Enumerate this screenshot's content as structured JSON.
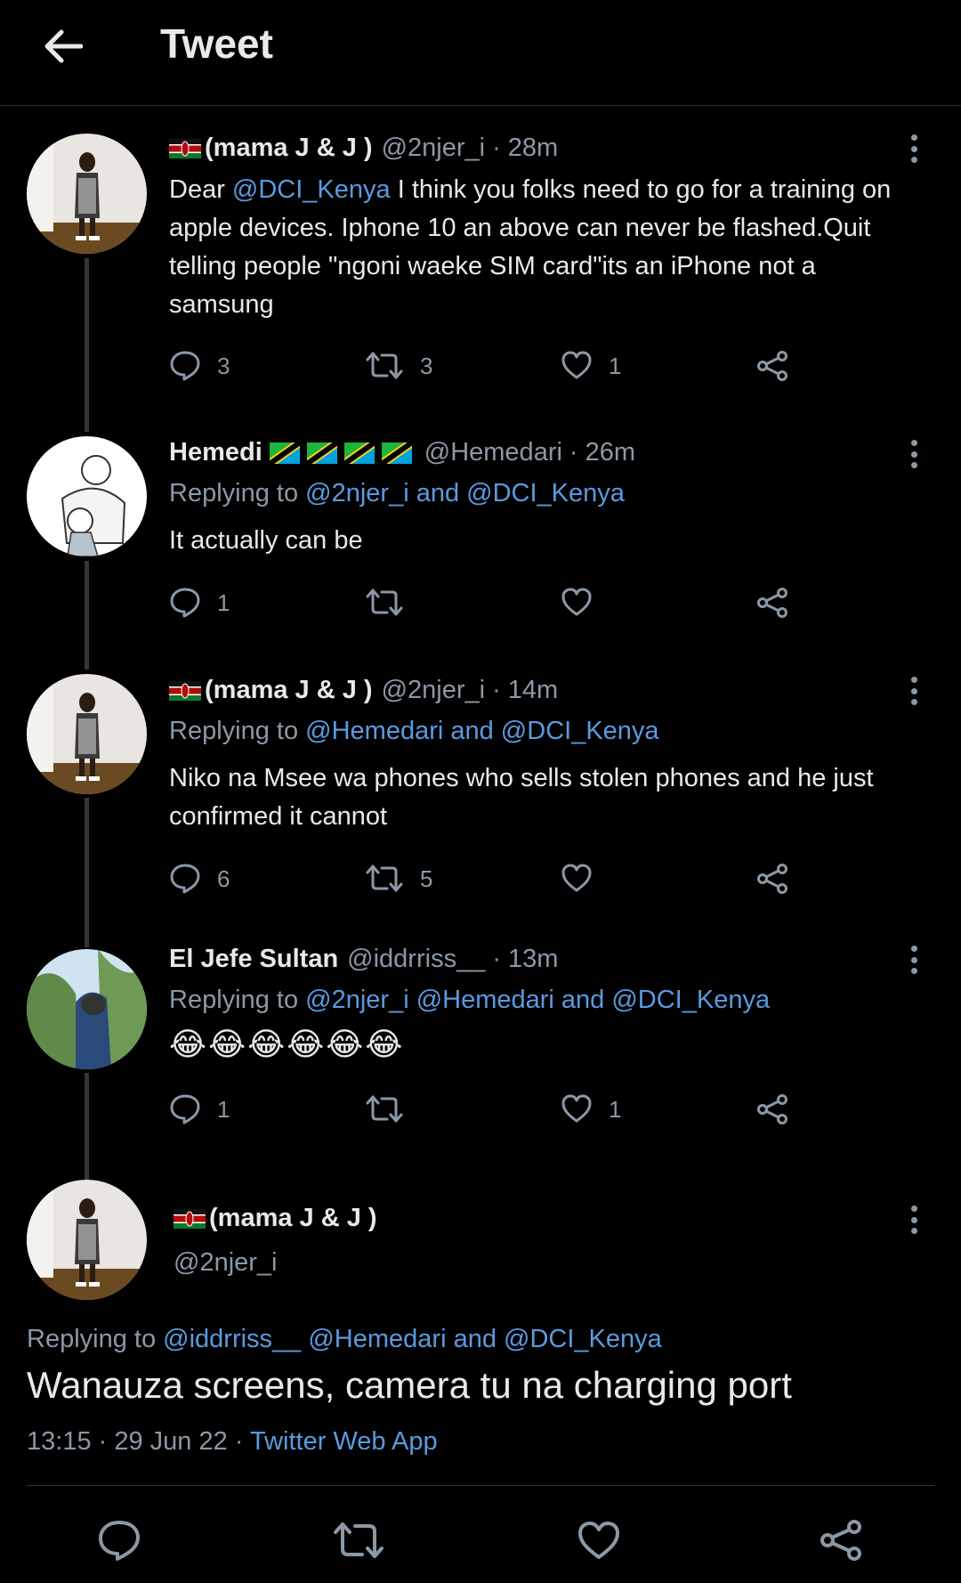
{
  "header": {
    "title": "Tweet"
  },
  "tweets": [
    {
      "name": "(mama J & J )",
      "handle": "@2njer_i",
      "time": "28m",
      "reply_prefix": "",
      "reply_mentions": "",
      "text_prefix": "Dear ",
      "text_mention": "@DCI_Kenya",
      "text_rest": " I think you folks need to go for a training on apple devices. Iphone 10 an above can never be flashed.Quit telling people \"ngoni waeke SIM card\"its  an iPhone not a samsung",
      "replies": "3",
      "retweets": "3",
      "likes": "1"
    },
    {
      "name": "Hemedi",
      "handle": "@Hemedari",
      "time": "26m",
      "reply_prefix": "Replying to ",
      "reply_mentions": "@2njer_i and @DCI_Kenya",
      "text": "It actually can be",
      "replies": "1",
      "retweets": "",
      "likes": ""
    },
    {
      "name": "(mama J & J )",
      "handle": "@2njer_i",
      "time": "14m",
      "reply_prefix": "Replying to ",
      "reply_mentions": "@Hemedari and @DCI_Kenya",
      "text": "Niko na Msee wa phones who sells stolen phones and he just confirmed it cannot",
      "replies": "6",
      "retweets": "5",
      "likes": ""
    },
    {
      "name": "El Jefe Sultan",
      "handle": "@iddrriss__",
      "time": "13m",
      "reply_prefix": "Replying to ",
      "reply_mentions": "@2njer_i @Hemedari and @DCI_Kenya",
      "text": "😂😂😂😂😂😂",
      "replies": "1",
      "retweets": "",
      "likes": "1"
    }
  ],
  "main_tweet": {
    "name": "(mama J & J )",
    "handle": "@2njer_i",
    "reply_prefix": "Replying to ",
    "reply_mentions": "@iddrriss__ @Hemedari and @DCI_Kenya",
    "text": "Wanauza screens, camera tu na charging port",
    "timestamp": "13:15 · 29 Jun 22 · ",
    "source": "Twitter Web App"
  },
  "icons": {
    "back": "arrow-left-icon",
    "reply": "reply-bubble-icon",
    "retweet": "retweet-icon",
    "like": "heart-icon",
    "share": "share-icon",
    "more": "more-vertical-icon"
  },
  "colors": {
    "background": "#000000",
    "text": "#e7e9ea",
    "secondary": "#8b98a5",
    "link": "#5b9ae0",
    "divider": "#2f3336"
  }
}
